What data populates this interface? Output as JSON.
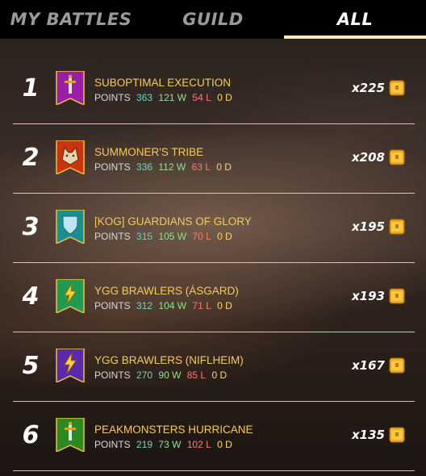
{
  "tabs": [
    {
      "label": "MY BATTLES",
      "active": false
    },
    {
      "label": "GUILD",
      "active": false
    },
    {
      "label": "ALL",
      "active": true
    }
  ],
  "rows": [
    {
      "rank": "1",
      "name": "SUBOPTIMAL EXECUTION",
      "points_label": "POINTS",
      "points": "363",
      "wins": "121 W",
      "losses": "54 L",
      "draws": "0 D",
      "reward": "x225",
      "banner_color": "#9b1fa6",
      "banner_icon": "sword-icon"
    },
    {
      "rank": "2",
      "name": "SUMMONER'S TRIBE",
      "points_label": "POINTS",
      "points": "336",
      "wins": "112 W",
      "losses": "63 L",
      "draws": "0 D",
      "reward": "x208",
      "banner_color": "#c9340f",
      "banner_icon": "wolf-icon"
    },
    {
      "rank": "3",
      "name": "[KOG] GUARDIANS OF GLORY",
      "points_label": "POINTS",
      "points": "315",
      "wins": "105 W",
      "losses": "70 L",
      "draws": "0 D",
      "reward": "x195",
      "banner_color": "#1a8f8f",
      "banner_icon": "shield-icon"
    },
    {
      "rank": "4",
      "name": "YGG BRAWLERS (ÁSGARD)",
      "points_label": "POINTS",
      "points": "312",
      "wins": "104 W",
      "losses": "71 L",
      "draws": "0 D",
      "reward": "x193",
      "banner_color": "#1f9a55",
      "banner_icon": "lightning-icon"
    },
    {
      "rank": "5",
      "name": "YGG BRAWLERS (NIFLHEIM)",
      "points_label": "POINTS",
      "points": "270",
      "wins": "90 W",
      "losses": "85 L",
      "draws": "0 D",
      "reward": "x167",
      "banner_color": "#5a2aa8",
      "banner_icon": "lightning-icon"
    },
    {
      "rank": "6",
      "name": "PEAKMONSTERS HURRICANE",
      "points_label": "POINTS",
      "points": "219",
      "wins": "73 W",
      "losses": "102 L",
      "draws": "0 D",
      "reward": "x135",
      "banner_color": "#2d8a22",
      "banner_icon": "sword-icon"
    }
  ],
  "reward_icon": "chest-icon",
  "colors": {
    "accent": "#f5cb5c",
    "divider": "#e8c77a",
    "active_tab_underline": "#ffe9b8"
  }
}
